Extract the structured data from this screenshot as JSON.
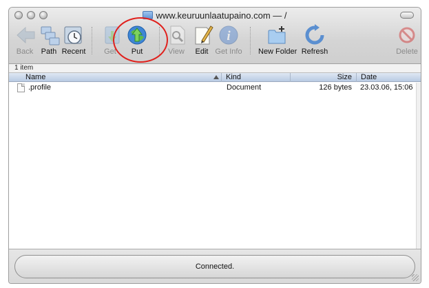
{
  "window": {
    "title": "www.keuruunlaatupaino.com — /"
  },
  "toolbar": {
    "buttons": [
      {
        "label": "Back",
        "icon": "back-arrow-icon",
        "enabled": false
      },
      {
        "label": "Path",
        "icon": "path-icon",
        "enabled": true
      },
      {
        "label": "Recent",
        "icon": "recent-icon",
        "enabled": true
      },
      {
        "label": "Get",
        "icon": "get-icon",
        "enabled": false
      },
      {
        "label": "Put",
        "icon": "put-globe-icon",
        "enabled": true
      },
      {
        "label": "View",
        "icon": "view-icon",
        "enabled": false
      },
      {
        "label": "Edit",
        "icon": "edit-icon",
        "enabled": true
      },
      {
        "label": "Get Info",
        "icon": "info-icon",
        "enabled": false
      },
      {
        "label": "New Folder",
        "icon": "new-folder-icon",
        "enabled": true
      },
      {
        "label": "Refresh",
        "icon": "refresh-icon",
        "enabled": true
      },
      {
        "label": "Delete",
        "icon": "delete-icon",
        "enabled": false
      }
    ]
  },
  "item_count": "1 item",
  "table": {
    "columns": [
      "Name",
      "Kind",
      "Size",
      "Date"
    ],
    "rows": [
      {
        "name": ".profile",
        "kind": "Document",
        "size": "126 bytes",
        "date": "23.03.06, 15:06"
      }
    ]
  },
  "status": "Connected.",
  "colors": {
    "highlight_circle": "#e0201c",
    "header_blue": "#b9cbe3"
  }
}
